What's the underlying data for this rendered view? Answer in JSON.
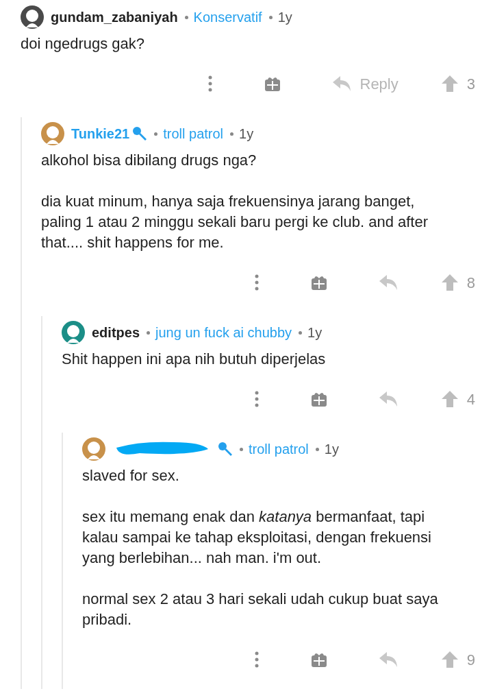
{
  "comments": [
    {
      "author": "gundam_zabaniyah",
      "redacted": false,
      "is_op": false,
      "avatar": {
        "color": "#4a4a4a"
      },
      "flair": "Konservatif",
      "time": "1y",
      "body": [
        "doi ngedrugs gak?"
      ],
      "reply_label": "Reply",
      "votes": "3",
      "children": [
        {
          "author": "Tunkie21",
          "redacted": false,
          "is_op": true,
          "avatar": {
            "color": "#c8914a"
          },
          "flair": "troll patrol",
          "time": "1y",
          "body": [
            "alkohol bisa dibilang drugs nga?",
            "dia kuat minum, hanya saja frekuensinya jarang banget, paling 1 atau 2 minggu sekali baru pergi ke club. and after that.... shit happens for me."
          ],
          "votes": "8",
          "children": [
            {
              "author": "editpes",
              "redacted": false,
              "is_op": false,
              "avatar": {
                "color": "#1b8e87"
              },
              "flair": "jung un fuck ai chubby",
              "time": "1y",
              "body": [
                "Shit happen ini apa nih butuh diperjelas"
              ],
              "votes": "4",
              "children": [
                {
                  "redacted": true,
                  "is_op": true,
                  "avatar": {
                    "color": "#c8914a"
                  },
                  "flair": "troll patrol",
                  "time": "1y",
                  "body": [
                    "slaved for sex.",
                    "sex itu memang enak dan *katanya* bermanfaat, tapi kalau sampai ke tahap eksploitasi, dengan frekuensi yang berlebihan... nah man. i'm out.",
                    "normal sex 2 atau 3 hari sekali udah cukup buat saya pribadi."
                  ],
                  "votes": "9"
                }
              ]
            }
          ]
        }
      ]
    }
  ]
}
